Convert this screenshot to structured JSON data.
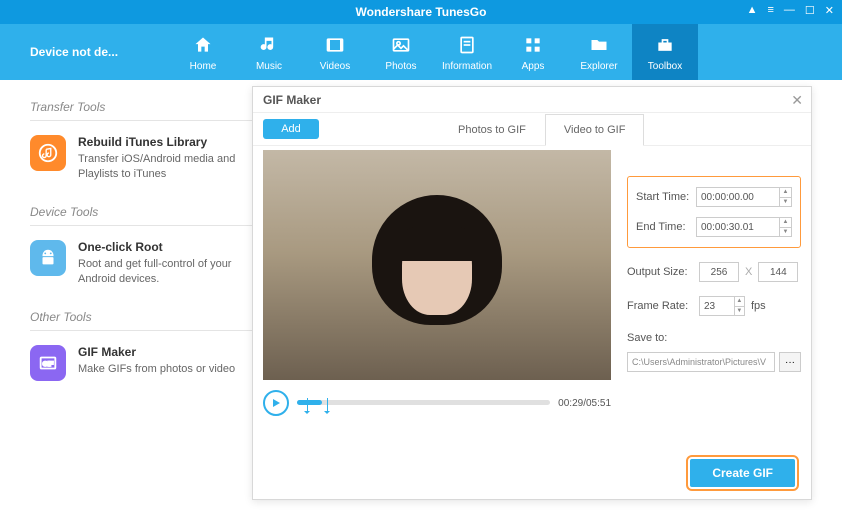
{
  "app": {
    "title": "Wondershare TunesGo"
  },
  "device": {
    "status": "Device not de..."
  },
  "nav": [
    {
      "key": "home",
      "label": "Home"
    },
    {
      "key": "music",
      "label": "Music"
    },
    {
      "key": "videos",
      "label": "Videos"
    },
    {
      "key": "photos",
      "label": "Photos"
    },
    {
      "key": "information",
      "label": "Information"
    },
    {
      "key": "apps",
      "label": "Apps"
    },
    {
      "key": "explorer",
      "label": "Explorer"
    },
    {
      "key": "toolbox",
      "label": "Toolbox",
      "active": true
    }
  ],
  "sidebar": {
    "sections": [
      {
        "title": "Transfer Tools",
        "items": [
          {
            "title": "Rebuild iTunes Library",
            "desc": "Transfer iOS/Android media and Playlists to iTunes",
            "color": "orange",
            "icon": "itunes"
          }
        ]
      },
      {
        "title": "Device Tools",
        "items": [
          {
            "title": "One-click Root",
            "desc": "Root and get full-control of your Android devices.",
            "color": "blue",
            "icon": "android"
          }
        ]
      },
      {
        "title": "Other Tools",
        "items": [
          {
            "title": "GIF Maker",
            "desc": "Make GIFs from photos or video",
            "color": "purple",
            "icon": "gif"
          }
        ]
      }
    ]
  },
  "modal": {
    "title": "GIF Maker",
    "add_label": "Add",
    "tabs": {
      "photos": "Photos to GIF",
      "video": "Video to GIF"
    },
    "time": {
      "start_label": "Start Time:",
      "start_value": "00:00:00.00",
      "end_label": "End Time:",
      "end_value": "00:00:30.01"
    },
    "output": {
      "size_label": "Output Size:",
      "width": "256",
      "height": "144",
      "x": "X"
    },
    "framerate": {
      "label": "Frame Rate:",
      "value": "23",
      "unit": "fps"
    },
    "save": {
      "label": "Save to:",
      "path": "C:\\Users\\Administrator\\Pictures\\V",
      "browse": "···"
    },
    "playback": {
      "time": "00:29/05:51"
    },
    "create_label": "Create GIF"
  }
}
